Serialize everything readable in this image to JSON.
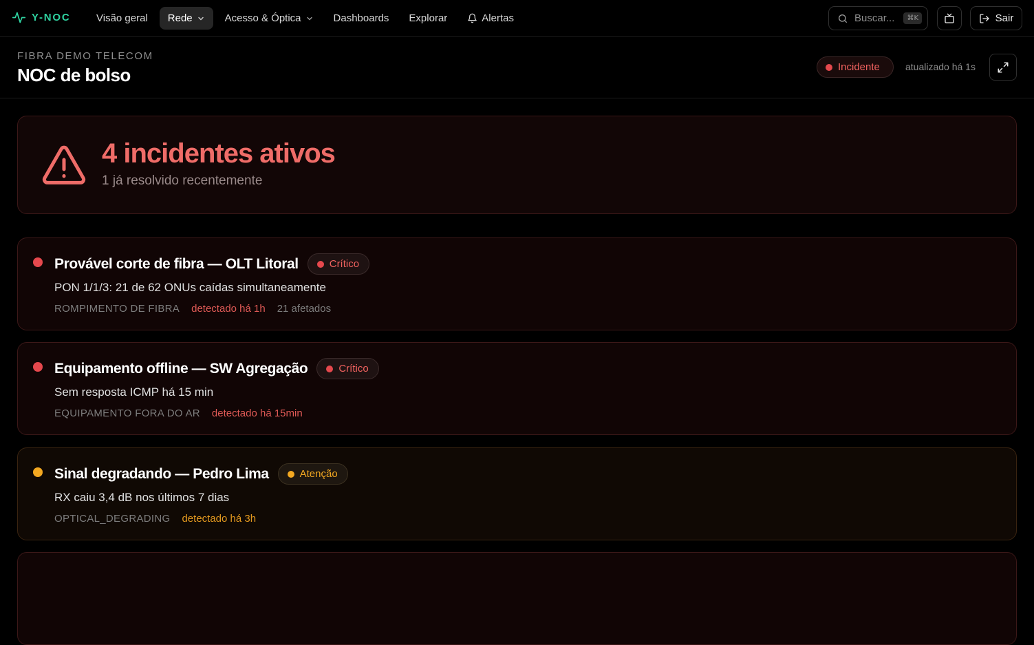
{
  "nav": {
    "logo": "Y-NOC",
    "items": [
      {
        "label": "Visão geral",
        "active": false,
        "dropdown": false
      },
      {
        "label": "Rede",
        "active": true,
        "dropdown": true
      },
      {
        "label": "Acesso & Óptica",
        "active": false,
        "dropdown": true
      },
      {
        "label": "Dashboards",
        "active": false,
        "dropdown": false
      },
      {
        "label": "Explorar",
        "active": false,
        "dropdown": false
      },
      {
        "label": "Alertas",
        "active": false,
        "dropdown": false,
        "icon": "bell-icon"
      }
    ],
    "search_placeholder": "Buscar...",
    "search_shortcut": "⌘K",
    "logout_label": "Sair"
  },
  "header": {
    "org": "FIBRA DEMO TELECOM",
    "title": "NOC de bolso",
    "status": "Incidente",
    "updated": "atualizado há 1s"
  },
  "summary": {
    "title": "4 incidentes ativos",
    "subtitle": "1 já resolvido recentemente"
  },
  "incidents": [
    {
      "title": "Provável corte de fibra — OLT Litoral",
      "severity": "Crítico",
      "level": "crit",
      "description": "PON 1/1/3: 21 de 62 ONUs caídas simultaneamente",
      "type": "ROMPIMENTO DE FIBRA",
      "detected": "detectado há 1h",
      "affected": "21 afetados"
    },
    {
      "title": "Equipamento offline — SW Agregação",
      "severity": "Crítico",
      "level": "crit",
      "description": "Sem resposta ICMP há 15 min",
      "type": "EQUIPAMENTO FORA DO AR",
      "detected": "detectado há 15min",
      "affected": ""
    },
    {
      "title": "Sinal degradando — Pedro Lima",
      "severity": "Atenção",
      "level": "warn",
      "description": "RX caiu 3,4 dB nos últimos 7 dias",
      "type": "OPTICAL_DEGRADING",
      "detected": "detectado há 3h",
      "affected": ""
    }
  ],
  "colors": {
    "brand": "#2fd3a1",
    "critical": "#e5484d",
    "warning": "#f3a821",
    "background": "#000000"
  }
}
